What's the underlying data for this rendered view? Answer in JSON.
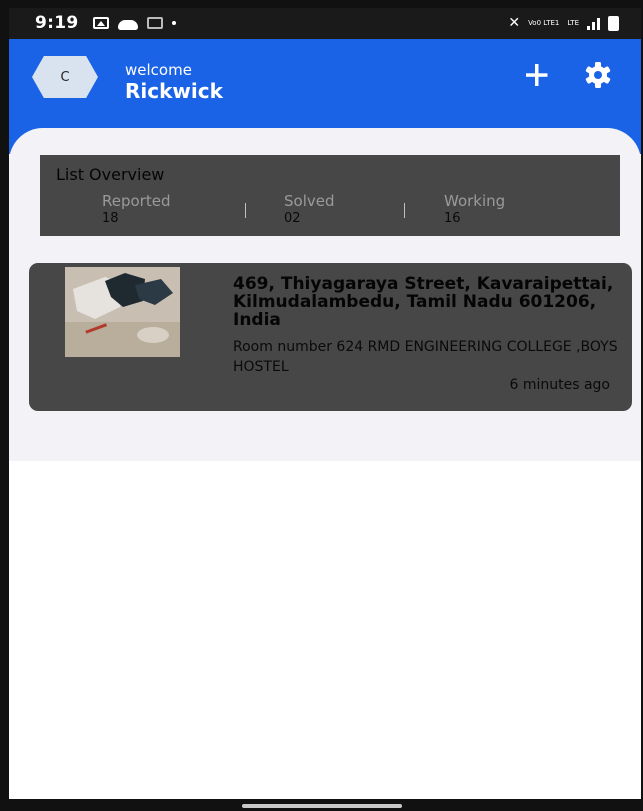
{
  "status_bar": {
    "time": "9:19",
    "network_label": "Vo0 LTE1",
    "lte_label": "LTE"
  },
  "header": {
    "avatar_initial": "C",
    "welcome": "welcome",
    "username": "Rickwick",
    "accent_color": "#1a63e6"
  },
  "overview": {
    "title": "List Overview",
    "stats": [
      {
        "label": "Reported",
        "value": "18"
      },
      {
        "label": "Solved",
        "value": "02"
      },
      {
        "label": "Working",
        "value": "16"
      }
    ]
  },
  "reports": [
    {
      "address": "469, Thiyagaraya Street, Kavaraipettai, Kilmudalambedu, Tamil Nadu 601206, India",
      "room": "Room number 624 RMD ENGINEERING COLLEGE ,BOYS HOSTEL",
      "time_ago": "6 minutes ago"
    }
  ],
  "icons": {
    "add": "plus-icon",
    "settings": "gear-icon"
  }
}
